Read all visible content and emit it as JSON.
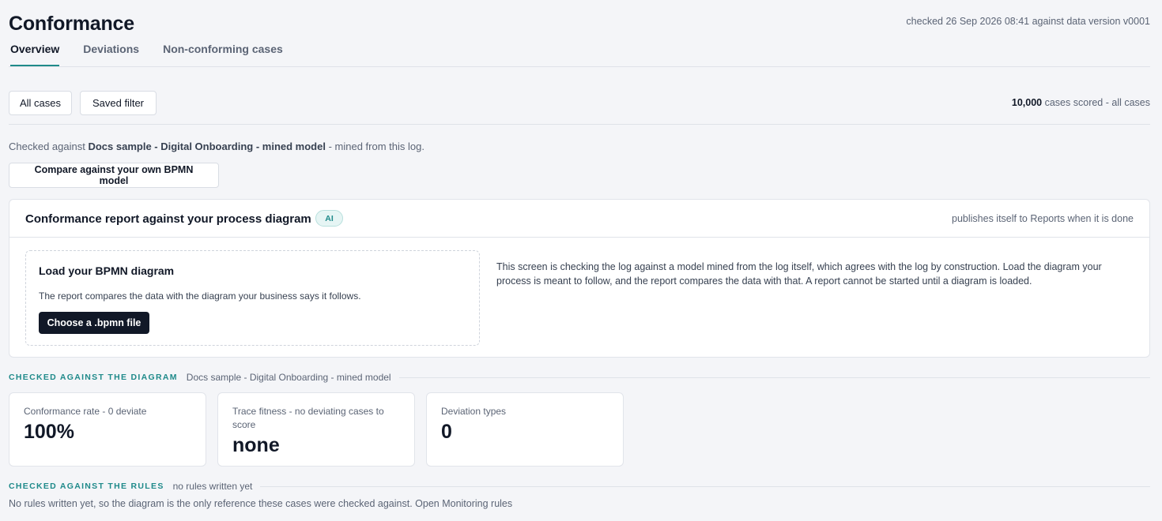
{
  "header": {
    "title": "Conformance",
    "checked_meta": "checked 26 Sep 2026 08:41 against data version v0001",
    "tabs": [
      {
        "label": "Overview",
        "active": true
      },
      {
        "label": "Deviations",
        "active": false
      },
      {
        "label": "Non-conforming cases",
        "active": false
      }
    ]
  },
  "filters": {
    "all_cases_label": "All cases",
    "saved_filter_label": "Saved filter",
    "cases_scored_count": "10,000",
    "cases_scored_suffix": "cases scored - all cases"
  },
  "model_source": {
    "prefix": "Checked against",
    "model_name": "Docs sample - Digital Onboarding - mined model",
    "suffix": "- mined from this log.",
    "compare_button_label": "Compare against your own BPMN model"
  },
  "report": {
    "title": "Conformance report against your process diagram",
    "badge": "AI",
    "note": "publishes itself to Reports when it is done",
    "upload": {
      "title": "Load your BPMN diagram",
      "description": "The report compares the data with the diagram your business says it follows.",
      "button_label": "Choose a .bpmn file"
    },
    "explanation": "This screen is checking the log against a model mined from the log itself, which agrees with the log by construction. Load the diagram your process is meant to follow, and the report compares the data with that. A report cannot be started until a diagram is loaded."
  },
  "diagram_section": {
    "label": "CHECKED AGAINST THE DIAGRAM",
    "subtitle": "Docs sample - Digital Onboarding - mined model",
    "metrics": [
      {
        "label": "Conformance rate - 0 deviate",
        "value": "100%"
      },
      {
        "label": "Trace fitness - no deviating cases to score",
        "value": "none"
      },
      {
        "label": "Deviation types",
        "value": "0"
      }
    ]
  },
  "rules_section": {
    "label": "CHECKED AGAINST THE RULES",
    "subtitle": "no rules written yet",
    "note": "No rules written yet, so the diagram is the only reference these cases were checked against. Open Monitoring rules"
  },
  "colors": {
    "accent": "#1f8a8a",
    "background": "#f4f5f8",
    "primary_button": "#111827"
  }
}
